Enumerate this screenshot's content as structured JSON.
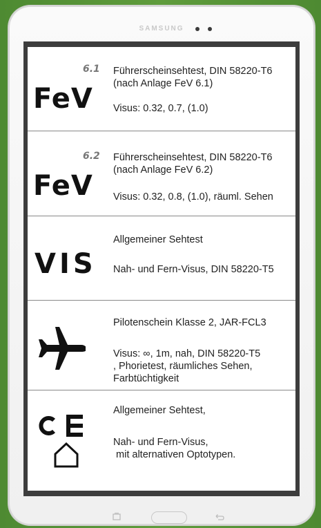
{
  "device": {
    "brand": "SAMSUNG"
  },
  "tests": [
    {
      "logo": "FeV",
      "version": "6.1",
      "title_line1": "Führerscheinsehtest, DIN 58220-T6",
      "title_line2": "(nach Anlage FeV 6.1)",
      "detail": "Visus: 0.32, 0.7, (1.0)"
    },
    {
      "logo": "FeV",
      "version": "6.2",
      "title_line1": "Führerscheinsehtest, DIN 58220-T6",
      "title_line2": "(nach Anlage FeV 6.2)",
      "detail": "Visus: 0.32, 0.8, (1.0), räuml. Sehen"
    },
    {
      "logo": "VIS",
      "title_line1": "Allgemeiner Sehtest",
      "detail": "Nah- und Fern-Visus, DIN 58220-T5"
    },
    {
      "icon": "airplane-icon",
      "title_line1": "Pilotenschein Klasse 2, JAR-FCL3",
      "detail_line1": "Visus: ∞, 1m, nah, DIN 58220-T5",
      "detail_line2": ", Phorietest, räumliches Sehen,",
      "detail_line3": "Farbtüchtigkeit"
    },
    {
      "icon": "optotypes-icon",
      "title_line1": "Allgemeiner Sehtest,",
      "detail_line1": "Nah- und Fern-Visus,",
      "detail_line2": " mit alternativen Optotypen."
    }
  ],
  "navbar": {
    "recent": "recent-apps-icon",
    "home": "home-button",
    "back": "back-icon"
  }
}
